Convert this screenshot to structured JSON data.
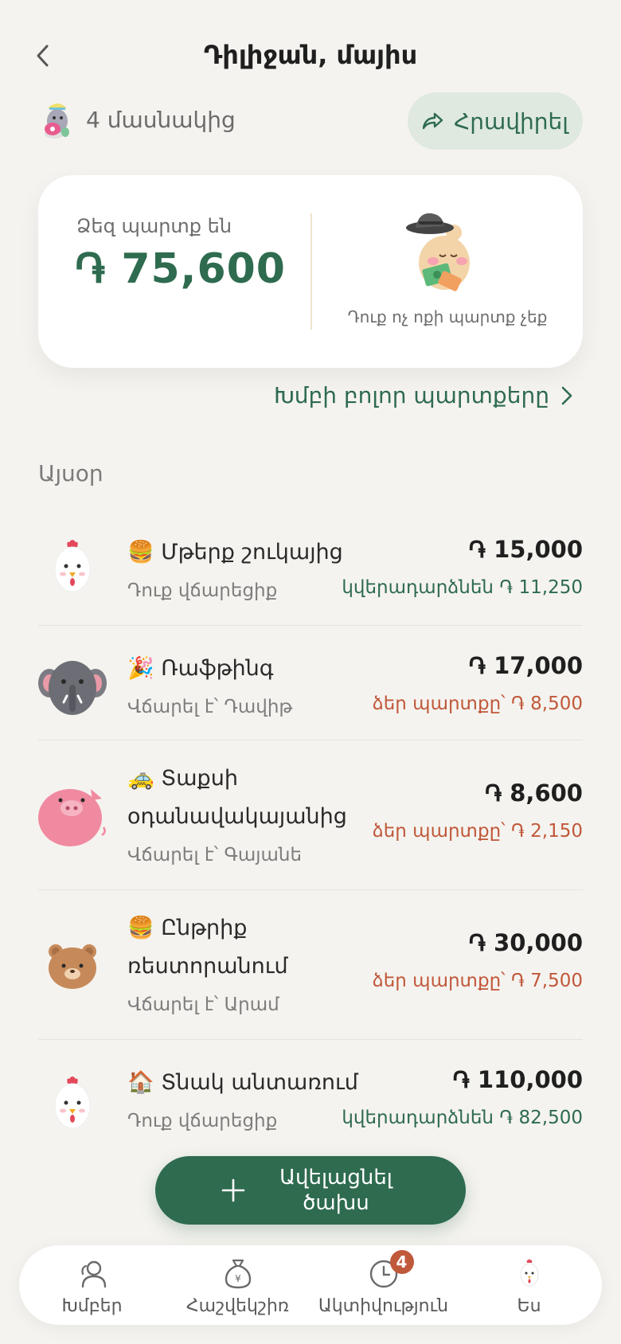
{
  "header": {
    "title": "Դիլիջան, մայիս"
  },
  "members": {
    "count_label": "4 մասնակից",
    "invite_label": "Հրավիրել"
  },
  "summary": {
    "owe_label": "Ձեզ պարտք են",
    "owe_amount": "֏ 75,600",
    "no_debt_text": "Դուք ոչ ոքի պարտք չեք"
  },
  "all_debts_label": "Խմբի բոլոր պարտքերը",
  "section_label": "Այսօր",
  "expenses": [
    {
      "avatar": "chicken",
      "title": "🍔 Մթերք շուկայից",
      "subtitle": "Դուք վճարեցիք",
      "amount": "֏ 15,000",
      "status": "կվերադարձնեն ֏ 11,250",
      "status_type": "green"
    },
    {
      "avatar": "elephant",
      "title": "🎉 Ռաֆթինգ",
      "subtitle": "Վճարել է՝ Դավիթ",
      "amount": "֏ 17,000",
      "status": "ձեր պարտքը՝ ֏ 8,500",
      "status_type": "red"
    },
    {
      "avatar": "pig",
      "title": "🚕 Տաքսի օդանավակայանից",
      "subtitle": "Վճարել է՝ Գայանե",
      "amount": "֏ 8,600",
      "status": "ձեր պարտքը՝ ֏ 2,150",
      "status_type": "red"
    },
    {
      "avatar": "bear",
      "title": "🍔 Ընթրիք ռեստորանում",
      "subtitle": "Վճարել է՝ Արամ",
      "amount": "֏ 30,000",
      "status": "ձեր պարտքը՝ ֏ 7,500",
      "status_type": "red"
    },
    {
      "avatar": "chicken",
      "title": "🏠 Տնակ անտառում",
      "subtitle": "Դուք վճարեցիք",
      "amount": "֏ 110,000",
      "status": "կվերադարձնեն ֏ 82,500",
      "status_type": "green"
    }
  ],
  "add_button_label": "Ավելացնել ծախս",
  "nav": {
    "groups": "Խմբեր",
    "calculator": "Հաշվեկշիռ",
    "activity": "Ակտիվություն",
    "activity_badge": "4",
    "me": "Ես"
  },
  "colors": {
    "accent": "#2e6b4f",
    "debt": "#c0583a",
    "background": "#f5f3ef"
  }
}
